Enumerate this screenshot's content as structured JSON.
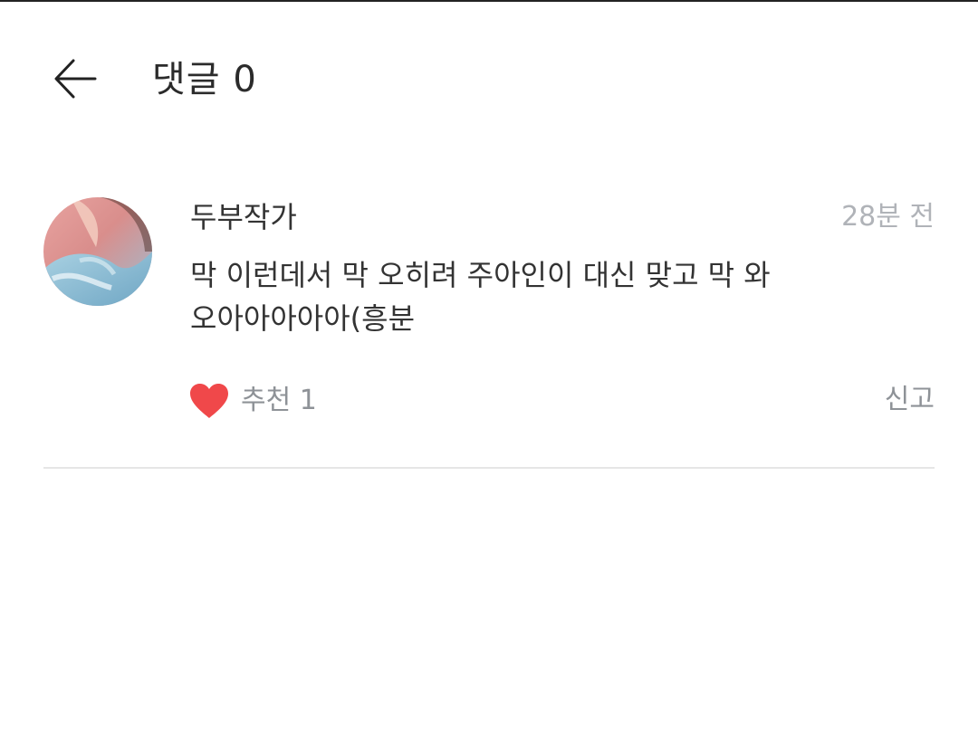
{
  "header": {
    "title": "댓글 0",
    "back_icon": "arrow-left-icon"
  },
  "comment": {
    "author": "두부작가",
    "time": "28분 전",
    "text_line1": "막 이런데서 막 오히려 주아인이 대신 맞고 막 와",
    "text_line2": "오아아아아아(흥분",
    "like_label": "추천 1",
    "like_icon": "heart-icon",
    "like_color": "#f0484a",
    "report_label": "신고"
  }
}
